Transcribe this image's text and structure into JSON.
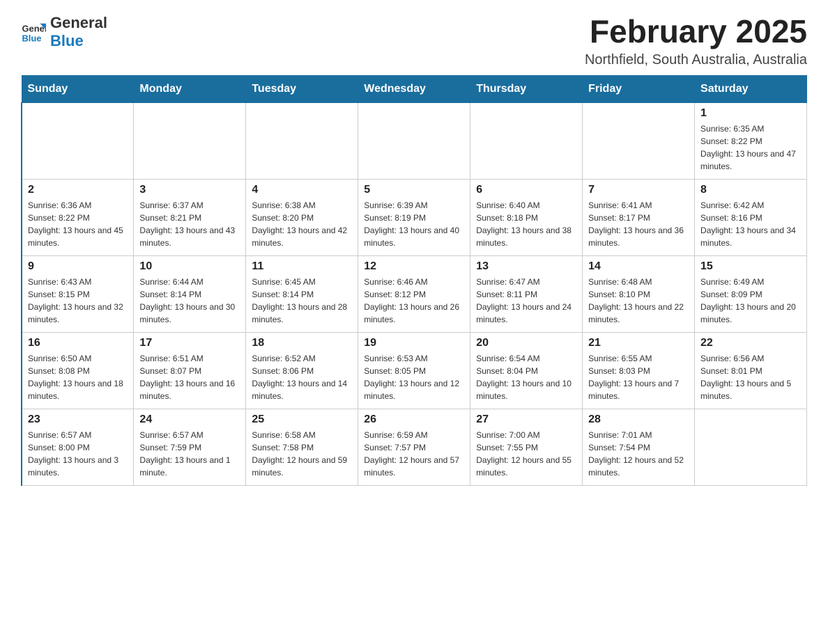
{
  "header": {
    "logo_general": "General",
    "logo_blue": "Blue",
    "title": "February 2025",
    "subtitle": "Northfield, South Australia, Australia"
  },
  "days_of_week": [
    "Sunday",
    "Monday",
    "Tuesday",
    "Wednesday",
    "Thursday",
    "Friday",
    "Saturday"
  ],
  "weeks": [
    [
      {
        "day": "",
        "info": ""
      },
      {
        "day": "",
        "info": ""
      },
      {
        "day": "",
        "info": ""
      },
      {
        "day": "",
        "info": ""
      },
      {
        "day": "",
        "info": ""
      },
      {
        "day": "",
        "info": ""
      },
      {
        "day": "1",
        "info": "Sunrise: 6:35 AM\nSunset: 8:22 PM\nDaylight: 13 hours and 47 minutes."
      }
    ],
    [
      {
        "day": "2",
        "info": "Sunrise: 6:36 AM\nSunset: 8:22 PM\nDaylight: 13 hours and 45 minutes."
      },
      {
        "day": "3",
        "info": "Sunrise: 6:37 AM\nSunset: 8:21 PM\nDaylight: 13 hours and 43 minutes."
      },
      {
        "day": "4",
        "info": "Sunrise: 6:38 AM\nSunset: 8:20 PM\nDaylight: 13 hours and 42 minutes."
      },
      {
        "day": "5",
        "info": "Sunrise: 6:39 AM\nSunset: 8:19 PM\nDaylight: 13 hours and 40 minutes."
      },
      {
        "day": "6",
        "info": "Sunrise: 6:40 AM\nSunset: 8:18 PM\nDaylight: 13 hours and 38 minutes."
      },
      {
        "day": "7",
        "info": "Sunrise: 6:41 AM\nSunset: 8:17 PM\nDaylight: 13 hours and 36 minutes."
      },
      {
        "day": "8",
        "info": "Sunrise: 6:42 AM\nSunset: 8:16 PM\nDaylight: 13 hours and 34 minutes."
      }
    ],
    [
      {
        "day": "9",
        "info": "Sunrise: 6:43 AM\nSunset: 8:15 PM\nDaylight: 13 hours and 32 minutes."
      },
      {
        "day": "10",
        "info": "Sunrise: 6:44 AM\nSunset: 8:14 PM\nDaylight: 13 hours and 30 minutes."
      },
      {
        "day": "11",
        "info": "Sunrise: 6:45 AM\nSunset: 8:14 PM\nDaylight: 13 hours and 28 minutes."
      },
      {
        "day": "12",
        "info": "Sunrise: 6:46 AM\nSunset: 8:12 PM\nDaylight: 13 hours and 26 minutes."
      },
      {
        "day": "13",
        "info": "Sunrise: 6:47 AM\nSunset: 8:11 PM\nDaylight: 13 hours and 24 minutes."
      },
      {
        "day": "14",
        "info": "Sunrise: 6:48 AM\nSunset: 8:10 PM\nDaylight: 13 hours and 22 minutes."
      },
      {
        "day": "15",
        "info": "Sunrise: 6:49 AM\nSunset: 8:09 PM\nDaylight: 13 hours and 20 minutes."
      }
    ],
    [
      {
        "day": "16",
        "info": "Sunrise: 6:50 AM\nSunset: 8:08 PM\nDaylight: 13 hours and 18 minutes."
      },
      {
        "day": "17",
        "info": "Sunrise: 6:51 AM\nSunset: 8:07 PM\nDaylight: 13 hours and 16 minutes."
      },
      {
        "day": "18",
        "info": "Sunrise: 6:52 AM\nSunset: 8:06 PM\nDaylight: 13 hours and 14 minutes."
      },
      {
        "day": "19",
        "info": "Sunrise: 6:53 AM\nSunset: 8:05 PM\nDaylight: 13 hours and 12 minutes."
      },
      {
        "day": "20",
        "info": "Sunrise: 6:54 AM\nSunset: 8:04 PM\nDaylight: 13 hours and 10 minutes."
      },
      {
        "day": "21",
        "info": "Sunrise: 6:55 AM\nSunset: 8:03 PM\nDaylight: 13 hours and 7 minutes."
      },
      {
        "day": "22",
        "info": "Sunrise: 6:56 AM\nSunset: 8:01 PM\nDaylight: 13 hours and 5 minutes."
      }
    ],
    [
      {
        "day": "23",
        "info": "Sunrise: 6:57 AM\nSunset: 8:00 PM\nDaylight: 13 hours and 3 minutes."
      },
      {
        "day": "24",
        "info": "Sunrise: 6:57 AM\nSunset: 7:59 PM\nDaylight: 13 hours and 1 minute."
      },
      {
        "day": "25",
        "info": "Sunrise: 6:58 AM\nSunset: 7:58 PM\nDaylight: 12 hours and 59 minutes."
      },
      {
        "day": "26",
        "info": "Sunrise: 6:59 AM\nSunset: 7:57 PM\nDaylight: 12 hours and 57 minutes."
      },
      {
        "day": "27",
        "info": "Sunrise: 7:00 AM\nSunset: 7:55 PM\nDaylight: 12 hours and 55 minutes."
      },
      {
        "day": "28",
        "info": "Sunrise: 7:01 AM\nSunset: 7:54 PM\nDaylight: 12 hours and 52 minutes."
      },
      {
        "day": "",
        "info": ""
      }
    ]
  ]
}
